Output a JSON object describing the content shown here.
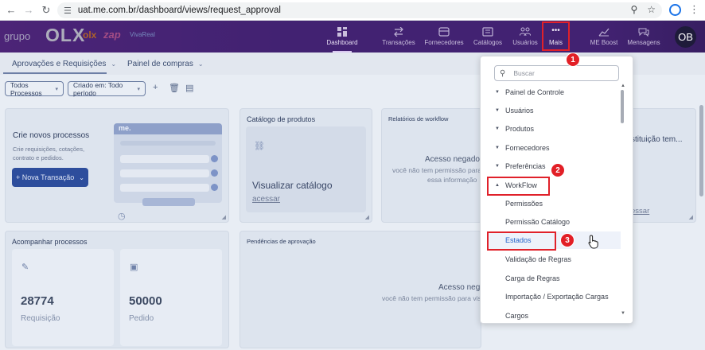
{
  "browser": {
    "url": "uat.me.com.br/dashboard/views/request_approval",
    "avatar_initials": "OB"
  },
  "brand": {
    "grupo": "grupo",
    "olx": "OLX",
    "olx_small": "olx",
    "zap": "zap",
    "vivareal": "VivaReal"
  },
  "nav": {
    "dashboard": "Dashboard",
    "transacoes": "Transações",
    "fornecedores": "Fornecedores",
    "catalogos": "Catálogos",
    "usuarios": "Usuários",
    "mais": "Mais",
    "meboost": "ME Boost",
    "mensagens": "Mensagens"
  },
  "user": {
    "initials": "OB"
  },
  "tabs": {
    "aprovacoes": "Aprovações e Requisições",
    "painel": "Painel de compras"
  },
  "filters": {
    "processos": "Todos Processos",
    "criado": "Criado em: Todo período"
  },
  "cards": {
    "novos": {
      "title": "Crie novos processos",
      "desc_line1": "Crie requisições, cotações,",
      "desc_line2": "contrato e pedidos.",
      "button": "+ Nova Transação",
      "preview_logo": "me."
    },
    "catalogo": {
      "title": "Catálogo de produtos",
      "link_title": "Visualizar catálogo",
      "link": "acessar"
    },
    "relatorios": {
      "title": "Relatórios de workflow",
      "denied": "Acesso negado",
      "denied_line1": "você não tem permissão para",
      "denied_line2": "essa informação"
    },
    "instituicao": {
      "title": "stituição tem...",
      "link": "essar"
    },
    "acompanhar": {
      "title": "Acompanhar processos",
      "stat1_value": "28774",
      "stat1_label": "Requisição",
      "stat2_value": "50000",
      "stat2_label": "Pedido"
    },
    "pendencias": {
      "title": "Pendências de aprovação",
      "denied": "Acesso nega",
      "denied_line": "você não tem permissão para visu"
    }
  },
  "dropdown": {
    "search_placeholder": "Buscar",
    "items": [
      {
        "label": "Painel de Controle"
      },
      {
        "label": "Usuários"
      },
      {
        "label": "Produtos"
      },
      {
        "label": "Fornecedores"
      },
      {
        "label": "Preferências"
      },
      {
        "label": "WorkFlow"
      },
      {
        "label": "Permissões"
      },
      {
        "label": "Permissão Catálogo"
      },
      {
        "label": "Estados"
      },
      {
        "label": "Validação de Regras"
      },
      {
        "label": "Carga de Regras"
      },
      {
        "label": "Importação / Exportação Cargas"
      },
      {
        "label": "Cargos"
      }
    ]
  },
  "annotations": {
    "badge1": "1",
    "badge2": "2",
    "badge3": "3"
  },
  "colors": {
    "highlight": "#e0212a",
    "header": "#5b2a8f",
    "link_active": "#2563c9"
  }
}
